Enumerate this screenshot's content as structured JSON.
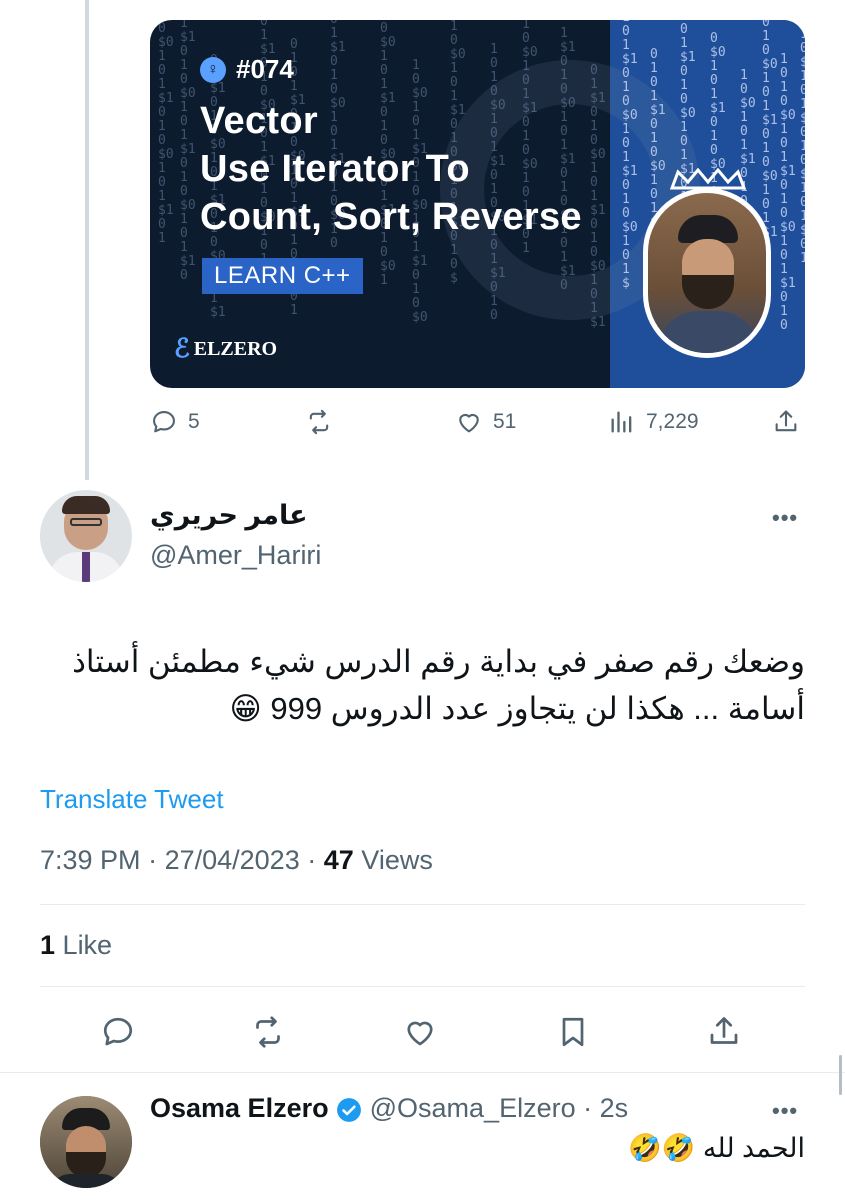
{
  "embedded_media": {
    "episode_number": "#074",
    "title_lines": [
      "Vector",
      "Use Iterator To",
      "Count, Sort, Reverse"
    ],
    "badge": "LEARN C++",
    "brand": "ELZERO"
  },
  "original_tweet_stats": {
    "replies": "5",
    "likes": "51",
    "views": "7,229"
  },
  "reply": {
    "display_name": "عامر حريري",
    "handle": "@Amer_Hariri",
    "text": "وضعك رقم صفر في بداية رقم الدرس شيء مطمئن أستاذ أسامة ... هكذا لن يتجاوز عدد الدروس 999 😁",
    "translate_label": "Translate Tweet",
    "time": "7:39 PM",
    "date": "27/04/2023",
    "views_count": "47",
    "views_label": "Views",
    "likes_count": "1",
    "likes_label": "Like"
  },
  "second_reply": {
    "display_name": "Osama Elzero",
    "handle": "@Osama_Elzero",
    "age": "2s",
    "text": "الحمد لله 🤣🤣"
  },
  "colors": {
    "accent": "#1d9bf0",
    "secondary_text": "#536471",
    "media_panel": "#1f4f9b"
  }
}
